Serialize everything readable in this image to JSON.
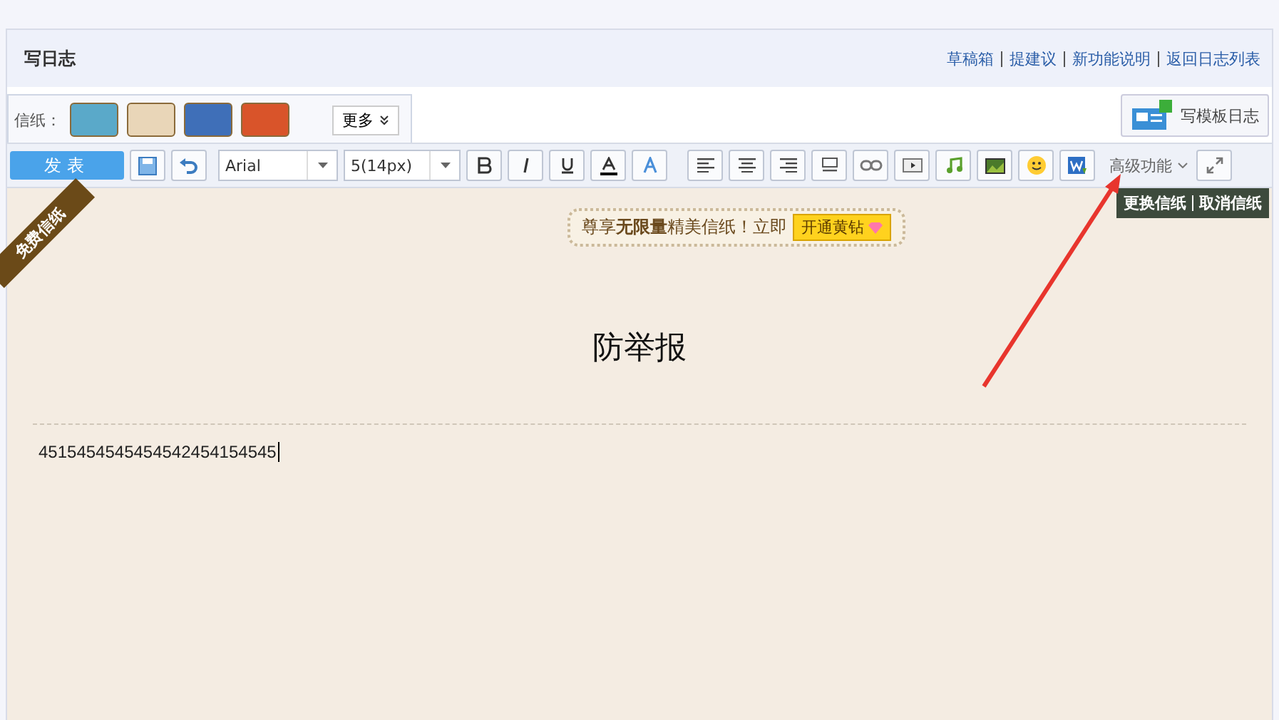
{
  "header": {
    "title": "写日志",
    "links": [
      "草稿箱",
      "提建议",
      "新功能说明",
      "返回日志列表"
    ]
  },
  "stationery": {
    "label": "信纸：",
    "thumbnails": [
      {
        "color": "#5aa9c9"
      },
      {
        "color": "#e9d6b8"
      },
      {
        "color": "#3f6fb8"
      },
      {
        "color": "#d9542a"
      }
    ],
    "more": "更多"
  },
  "template_button": "写模板日志",
  "toolbar": {
    "publish": "发表",
    "font": "Arial",
    "size": "5(14px)",
    "advanced": "高级功能"
  },
  "editor": {
    "ribbon": "免费信纸",
    "promo": "尊享**无限量**精美信纸！立即",
    "promo_button": "开通黄钻",
    "stationery_links": [
      "更换信纸",
      "取消信纸"
    ],
    "title": "防举报",
    "body": "4515454545454542454154545"
  }
}
